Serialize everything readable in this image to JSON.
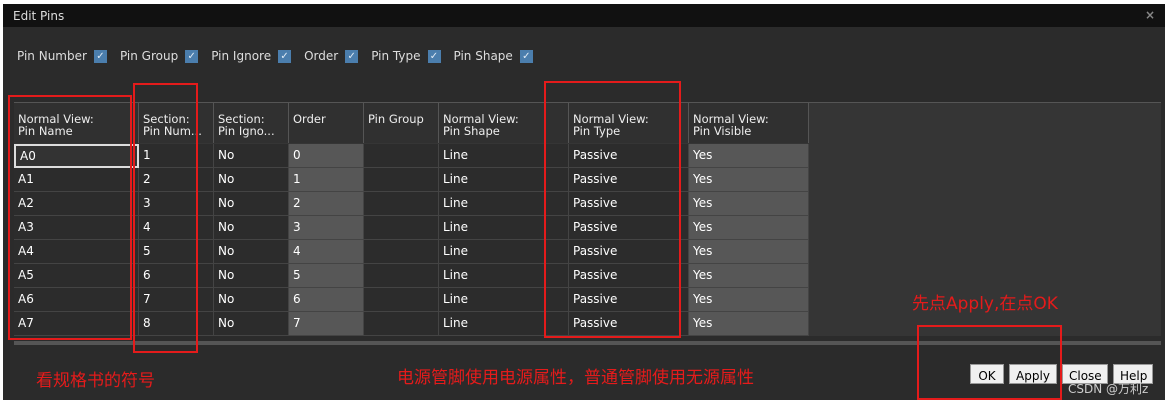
{
  "window": {
    "title": "Edit Pins",
    "close": "×"
  },
  "toolbar": [
    {
      "label": "Pin Number",
      "checked": true
    },
    {
      "label": "Pin Group",
      "checked": true
    },
    {
      "label": "Pin Ignore",
      "checked": true
    },
    {
      "label": "Order",
      "checked": true
    },
    {
      "label": "Pin Type",
      "checked": true
    },
    {
      "label": "Pin Shape",
      "checked": true
    }
  ],
  "grid": {
    "columns": [
      "Normal View:\nPin Name",
      "Section:\nPin Num...",
      "Section:\nPin Igno...",
      "Order",
      "Pin Group",
      "Normal View:\nPin Shape",
      "Normal View:\nPin Type",
      "Normal View:\nPin Visible"
    ],
    "rows": [
      [
        "A0",
        "1",
        "No",
        "0",
        "",
        "Line",
        "Passive",
        "Yes"
      ],
      [
        "A1",
        "2",
        "No",
        "1",
        "",
        "Line",
        "Passive",
        "Yes"
      ],
      [
        "A2",
        "3",
        "No",
        "2",
        "",
        "Line",
        "Passive",
        "Yes"
      ],
      [
        "A3",
        "4",
        "No",
        "3",
        "",
        "Line",
        "Passive",
        "Yes"
      ],
      [
        "A4",
        "5",
        "No",
        "4",
        "",
        "Line",
        "Passive",
        "Yes"
      ],
      [
        "A5",
        "6",
        "No",
        "5",
        "",
        "Line",
        "Passive",
        "Yes"
      ],
      [
        "A6",
        "7",
        "No",
        "6",
        "",
        "Line",
        "Passive",
        "Yes"
      ],
      [
        "A7",
        "8",
        "No",
        "7",
        "",
        "Line",
        "Passive",
        "Yes"
      ]
    ]
  },
  "buttons": {
    "ok": "OK",
    "apply": "Apply",
    "close": "Close",
    "help": "Help"
  },
  "annotations": {
    "spec": "看规格书的符号",
    "power": "电源管脚使用电源属性，普通管脚使用无源属性",
    "apply_then_ok": "先点Apply,在点OK"
  },
  "watermark": "CSDN @万利z"
}
